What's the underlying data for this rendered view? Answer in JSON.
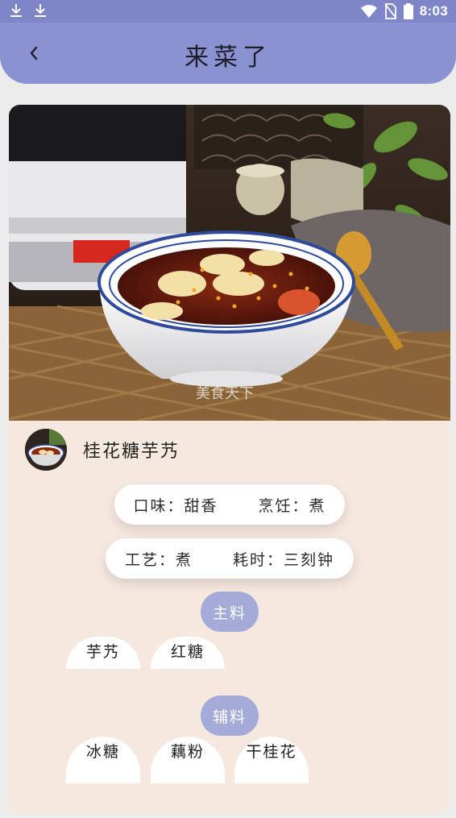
{
  "status_bar": {
    "time": "8:03",
    "icons": [
      "download-icon",
      "download-icon",
      "wifi-icon",
      "no-sim-icon",
      "battery-icon"
    ]
  },
  "header": {
    "title": "来菜了",
    "back_icon": "chevron-left-icon"
  },
  "recipe": {
    "name": "桂花糖芋艿",
    "image_watermark": "美食天下",
    "attributes_row1": [
      {
        "label": "口味：",
        "value": "甜香"
      },
      {
        "label": "烹饪：",
        "value": "煮"
      }
    ],
    "attributes_row2": [
      {
        "label": "工艺：",
        "value": "煮"
      },
      {
        "label": "耗时：",
        "value": "三刻钟"
      }
    ],
    "main_section_label": "主料",
    "main_ingredients": [
      "芋艿",
      "红糖"
    ],
    "aux_section_label": "辅料",
    "aux_ingredients": [
      "冰糖",
      "藕粉",
      "干桂花"
    ]
  },
  "colors": {
    "header": "#8a92d2",
    "status_bar": "#7f86c8",
    "card_background": "#f5e8df",
    "section_chip": "#a5abd9"
  }
}
